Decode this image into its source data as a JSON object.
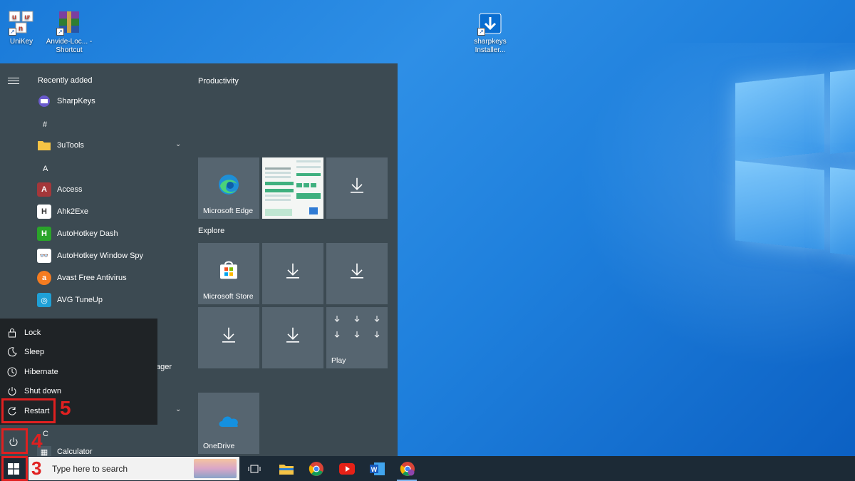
{
  "desktop": {
    "icons": [
      {
        "label": "UniKey",
        "icon": "unikey-icon"
      },
      {
        "label": "Anvide-Loc... - Shortcut",
        "icon": "winrar-icon"
      },
      {
        "label": "sharpkeys Installer...",
        "icon": "installer-download-icon"
      }
    ]
  },
  "start_menu": {
    "recently_added_title": "Recently added",
    "recent_items": [
      {
        "label": "SharpKeys",
        "icon": "sharpkeys-icon"
      }
    ],
    "hash_header": "#",
    "folder_3utools": "3uTools",
    "letter_a": "A",
    "apps": [
      {
        "label": "Access",
        "icon": "access-icon",
        "color": "#a4373a"
      },
      {
        "label": "Ahk2Exe",
        "icon": "ahk2exe-icon",
        "color": "#ffffff"
      },
      {
        "label": "AutoHotkey Dash",
        "icon": "autohotkey-icon",
        "color": "#2aa42a"
      },
      {
        "label": "AutoHotkey Window Spy",
        "icon": "window-spy-icon",
        "color": "#ffffff"
      },
      {
        "label": "Avast Free Antivirus",
        "icon": "avast-icon",
        "color": "#f57c20"
      },
      {
        "label": "AVG TuneUp",
        "icon": "avg-icon",
        "color": "#1fa0d6"
      }
    ],
    "partial_item_label": "ager",
    "letter_c": "C",
    "calculator_label": "Calculator",
    "tiles": {
      "productivity_title": "Productivity",
      "explore_title": "Explore",
      "edge_label": "Microsoft Edge",
      "store_label": "Microsoft Store",
      "play_label": "Play",
      "onedrive_label": "OneDrive"
    }
  },
  "power_menu": {
    "items": [
      {
        "label": "Lock",
        "icon": "lock-icon"
      },
      {
        "label": "Sleep",
        "icon": "sleep-icon"
      },
      {
        "label": "Hibernate",
        "icon": "hibernate-icon"
      },
      {
        "label": "Shut down",
        "icon": "shutdown-icon"
      },
      {
        "label": "Restart",
        "icon": "restart-icon"
      }
    ]
  },
  "annotations": {
    "step3": "3",
    "step4": "4",
    "step5": "5",
    "highlight_color": "#e02020"
  },
  "taskbar": {
    "search_placeholder": "Type here to search",
    "pinned": [
      "task-view-icon",
      "file-explorer-icon",
      "chrome-icon",
      "youtube-icon",
      "word-icon",
      "chrome-profile-icon"
    ]
  }
}
